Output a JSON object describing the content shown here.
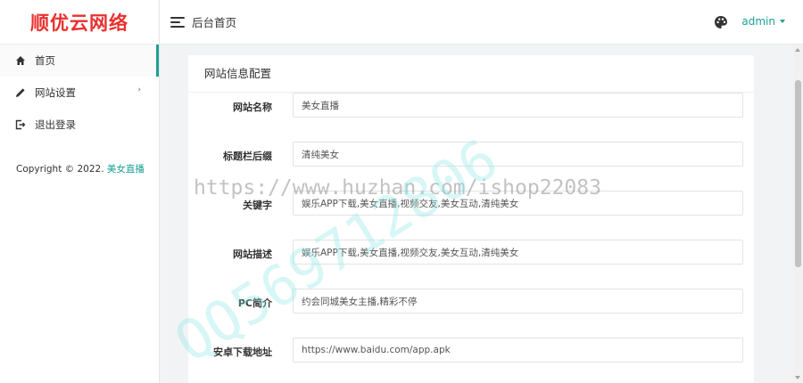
{
  "sidebar": {
    "logo": "顺优云网络",
    "items": [
      {
        "label": "首页",
        "icon": "home-icon",
        "active": true
      },
      {
        "label": "网站设置",
        "icon": "pencil-icon",
        "has_submenu": true
      },
      {
        "label": "退出登录",
        "icon": "logout-icon"
      }
    ],
    "copyright_prefix": "Copyright © 2022. ",
    "copyright_brand": "美女直播"
  },
  "header": {
    "title": "后台首页",
    "user": "admin"
  },
  "card": {
    "title": "网站信息配置",
    "fields": [
      {
        "label": "网站名称",
        "value": "美女直播"
      },
      {
        "label": "标题栏后缀",
        "value": "清纯美女"
      },
      {
        "label": "关键字",
        "value": "娱乐APP下载,美女直播,视频交友,美女互动,清纯美女"
      },
      {
        "label": "网站描述",
        "value": "娱乐APP下载,美女直播,视频交友,美女互动,清纯美女"
      },
      {
        "label": "PC简介",
        "value": "约会同城美女主播,精彩不停"
      },
      {
        "label": "安卓下载地址",
        "value": "https://www.baidu.com/app.apk"
      }
    ]
  },
  "watermark": {
    "url": "https://www.huzhan.com/ishop22083",
    "qq": "QQ569712806"
  },
  "colors": {
    "accent": "#1aa194",
    "logo": "#e8312f"
  }
}
